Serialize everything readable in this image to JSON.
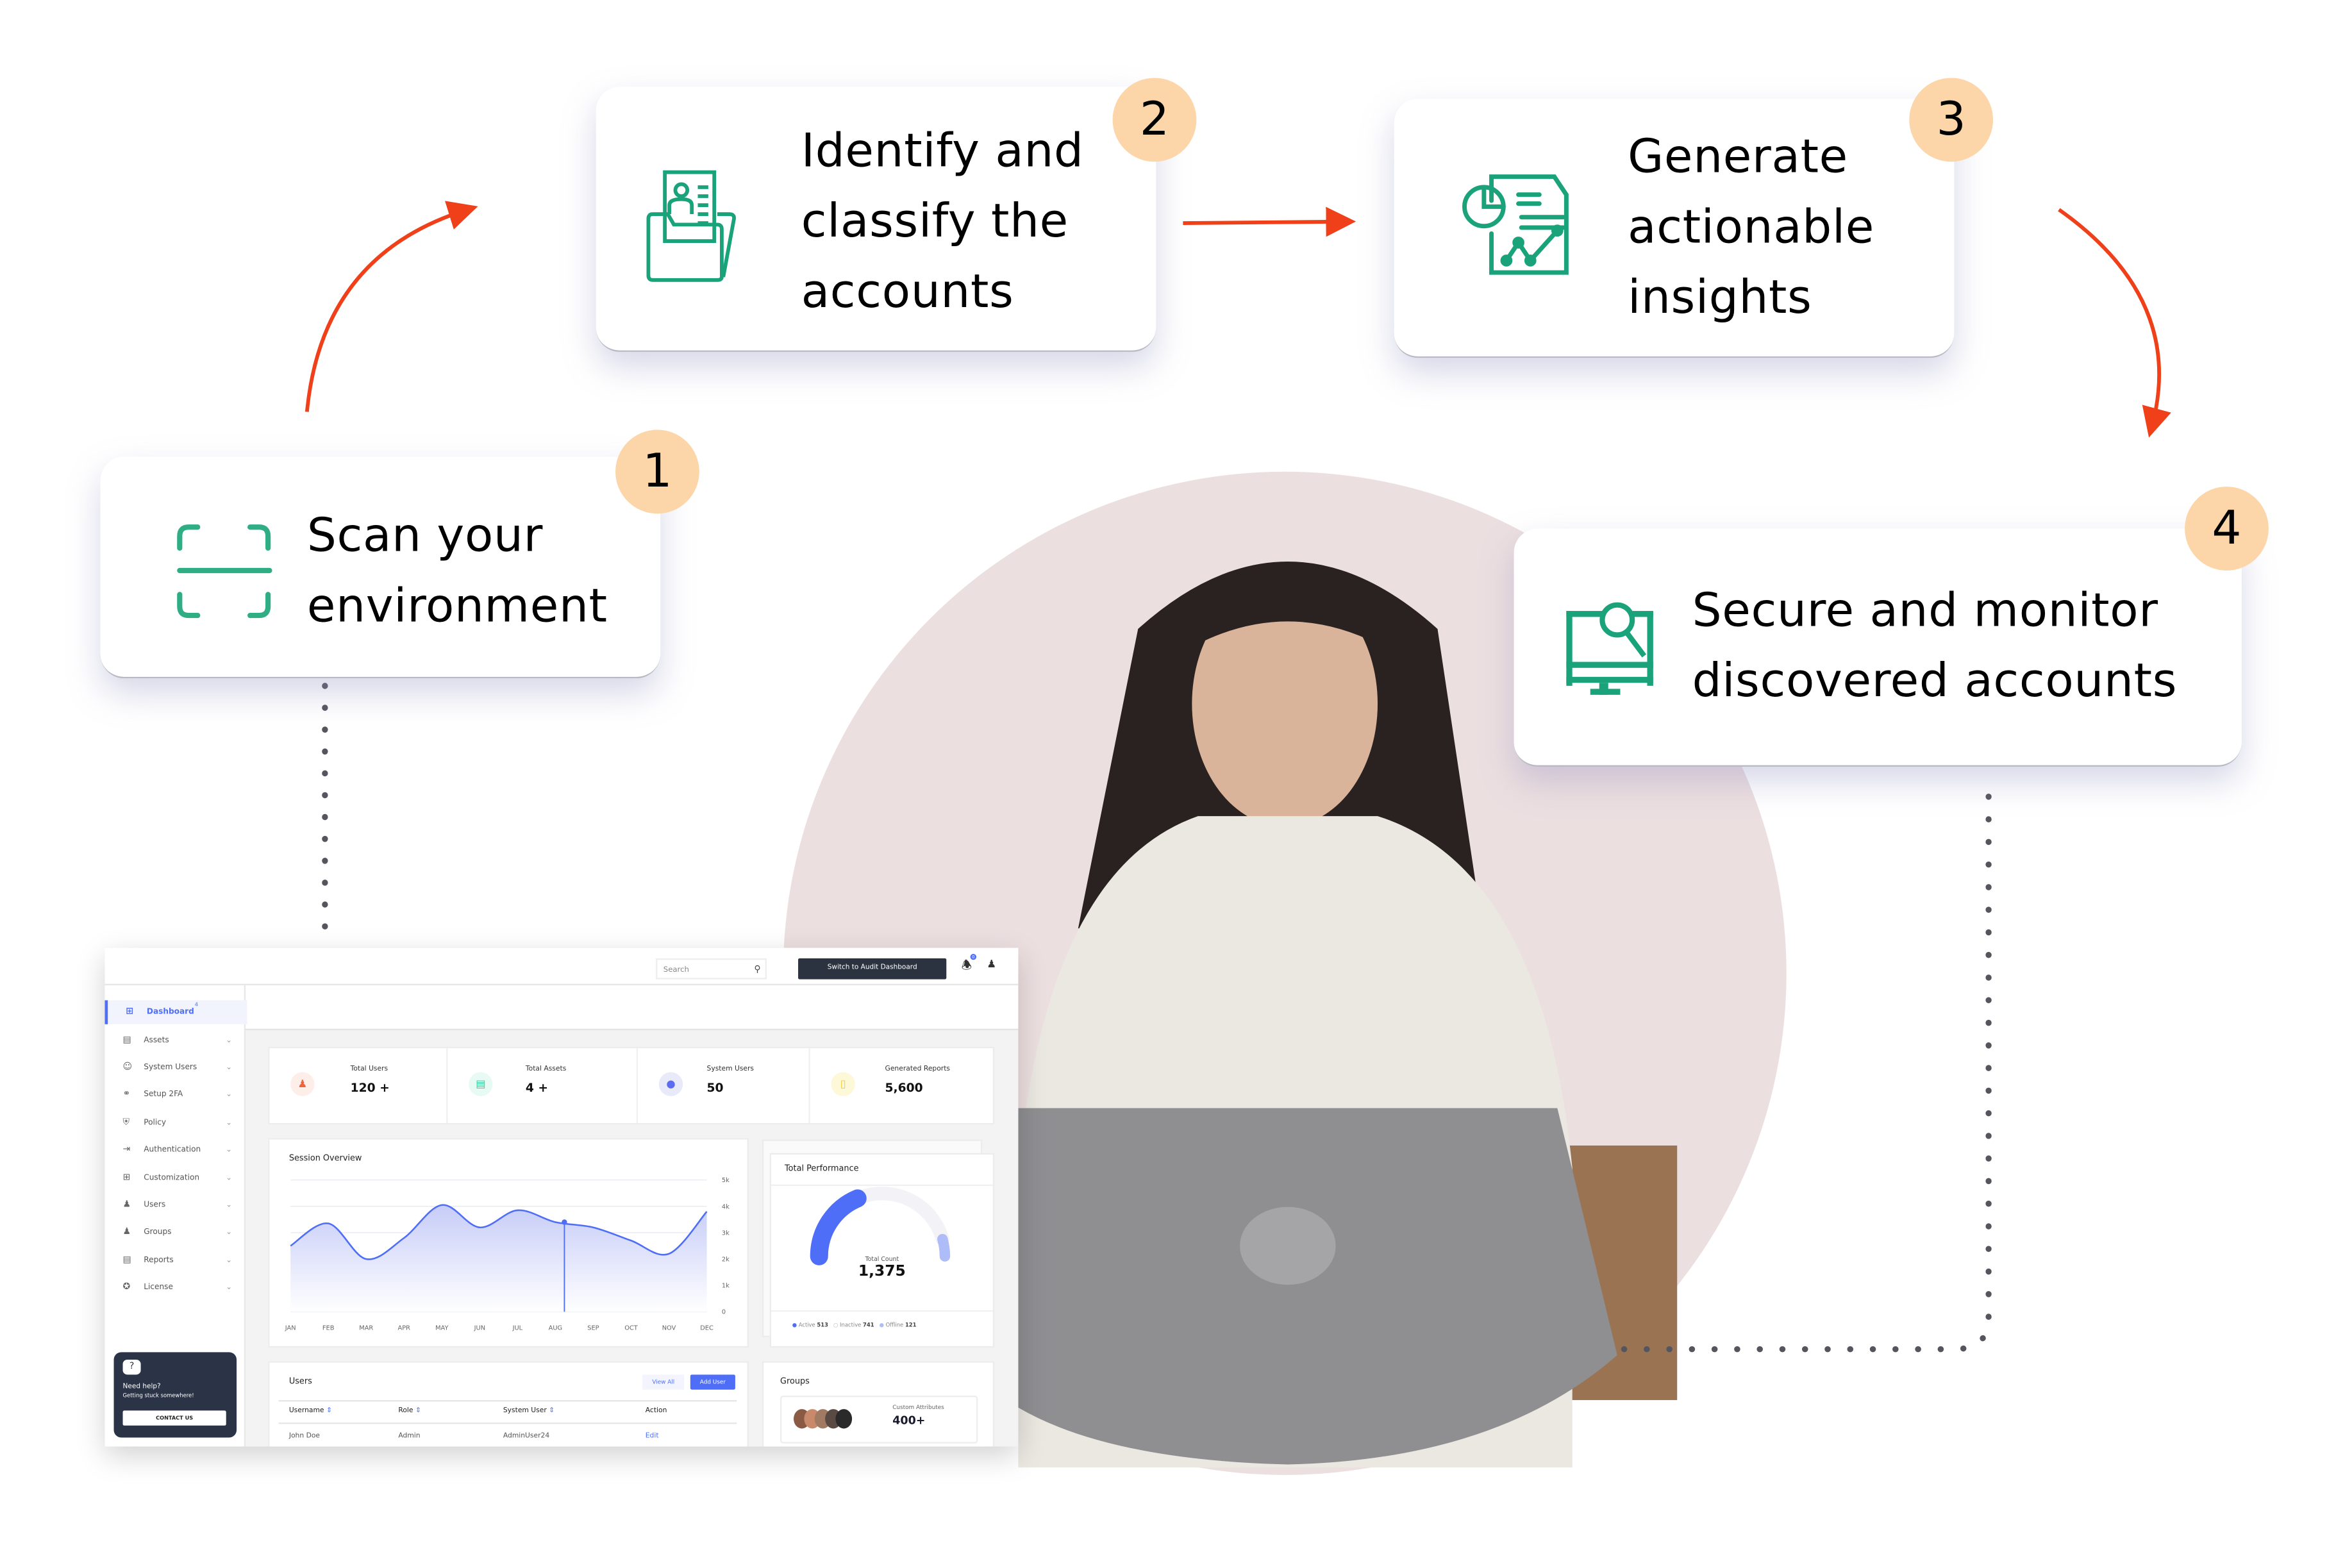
{
  "colors": {
    "accent_green": "#1aa37a",
    "arrow": "#f0401a",
    "badge": "#fcd6a8",
    "bg_circle": "#ecdfe0",
    "dashboard_blue": "#4f6ef7",
    "dark": "#2b3240"
  },
  "steps": [
    {
      "number": "1",
      "lines": [
        "Scan your",
        "environment"
      ],
      "icon": "scan-icon"
    },
    {
      "number": "2",
      "lines": [
        "Identify and",
        "classify the",
        "accounts"
      ],
      "icon": "folder-profile-icon"
    },
    {
      "number": "3",
      "lines": [
        "Generate",
        "actionable",
        "insights"
      ],
      "icon": "report-chart-icon"
    },
    {
      "number": "4",
      "lines": [
        "Secure and monitor",
        "discovered accounts"
      ],
      "icon": "monitor-search-icon"
    }
  ],
  "dashboard": {
    "header": {
      "search_placeholder": "Search",
      "switch_button": "Switch to Audit Dashboard",
      "notification_count": "0"
    },
    "sidebar": {
      "items": [
        {
          "label": "Dashboard",
          "badge": "4",
          "icon": "grid-icon",
          "active": true
        },
        {
          "label": "Assets",
          "icon": "server-icon"
        },
        {
          "label": "System Users",
          "icon": "user-circle-icon"
        },
        {
          "label": "Setup 2FA",
          "icon": "key-icon"
        },
        {
          "label": "Policy",
          "icon": "shield-icon"
        },
        {
          "label": "Authentication",
          "icon": "login-icon"
        },
        {
          "label": "Customization",
          "icon": "grid-plus-icon"
        },
        {
          "label": "Users",
          "icon": "user-icon"
        },
        {
          "label": "Groups",
          "icon": "users-icon"
        },
        {
          "label": "Reports",
          "icon": "report-icon"
        },
        {
          "label": "License",
          "icon": "badge-icon"
        }
      ],
      "help": {
        "title": "Need help?",
        "subtitle": "Getting stuck somewhere!",
        "button": "CONTACT US"
      }
    },
    "stats": [
      {
        "label": "Total Users",
        "value": "120 +",
        "color": "#f0643c",
        "bg": "#fdeee9"
      },
      {
        "label": "Total Assets",
        "value": "4 +",
        "color": "#2ed3a0",
        "bg": "#e8faf4"
      },
      {
        "label": "System Users",
        "value": "50",
        "color": "#5b6cf0",
        "bg": "#e8eaf9"
      },
      {
        "label": "Generated Reports",
        "value": "5,600",
        "color": "#f5d63a",
        "bg": "#fdf8d8"
      }
    ],
    "session_overview": {
      "title": "Session Overview"
    },
    "total_performance": {
      "title": "Total Performance",
      "count_label": "Total Count",
      "count": "1,375",
      "legend": [
        {
          "label": "Active",
          "value": "513",
          "color": "#4f6ef7"
        },
        {
          "label": "Inactive",
          "value": "741",
          "color": "#f2f2f7"
        },
        {
          "label": "Offline",
          "value": "121",
          "color": "#aebcf8"
        }
      ]
    },
    "users": {
      "title": "Users",
      "view_all": "View All",
      "add_user": "Add User",
      "columns": [
        "Username",
        "Role",
        "System User",
        "Action"
      ],
      "rows": [
        {
          "username": "John Doe",
          "role": "Admin",
          "system_user": "AdminUser24",
          "action": "Edit"
        }
      ]
    },
    "groups": {
      "title": "Groups",
      "attr_label": "Custom Attributes",
      "attr_value": "400+"
    }
  },
  "chart_data": {
    "type": "area",
    "title": "Session Overview",
    "categories": [
      "JAN",
      "FEB",
      "MAR",
      "APR",
      "MAY",
      "JUN",
      "JUL",
      "AUG",
      "SEP",
      "OCT",
      "NOV",
      "DEC"
    ],
    "values": [
      2500,
      3350,
      2000,
      2800,
      4050,
      3200,
      3850,
      3400,
      3200,
      2700,
      2200,
      3800
    ],
    "highlight_index": 7,
    "yticks": [
      "0",
      "1k",
      "2k",
      "3k",
      "4k",
      "5k"
    ],
    "ylim": [
      0,
      5000
    ],
    "grid": true
  }
}
